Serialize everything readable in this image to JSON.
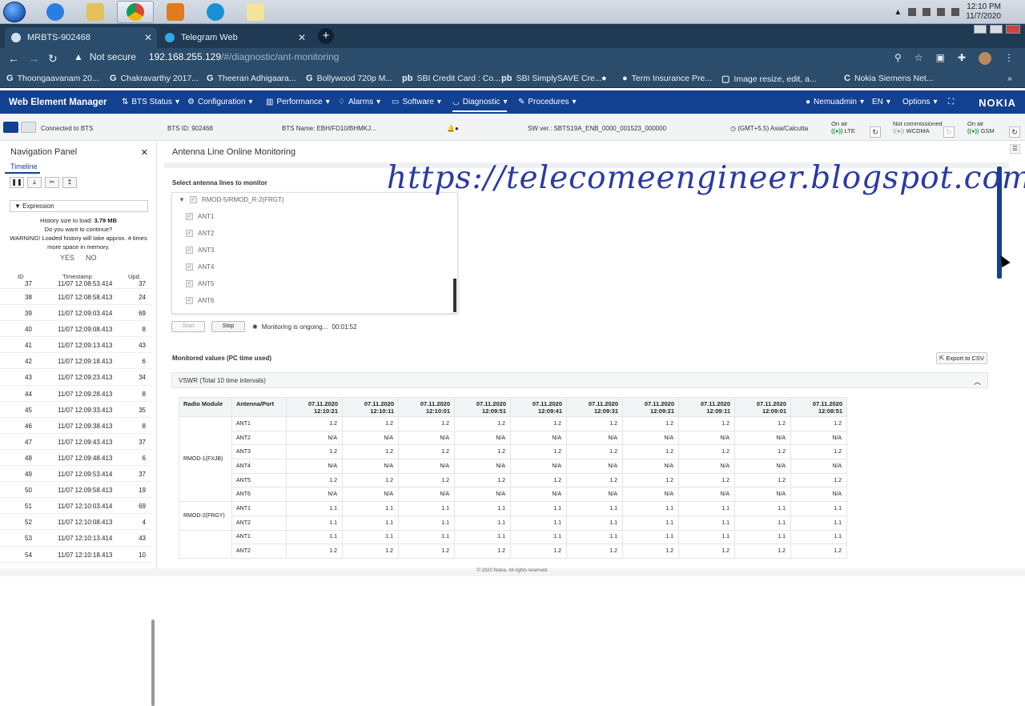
{
  "taskbar": {
    "clock_time": "12:10 PM",
    "clock_date": "11/7/2020"
  },
  "browser": {
    "tabs": [
      {
        "label": "MRBTS-902468",
        "active": true
      },
      {
        "label": "Telegram Web",
        "active": false
      }
    ],
    "new_tab": "+",
    "security_label": "Not secure",
    "url_host": "192.168.255.129",
    "url_path": "/#/diagnostic/ant-monitoring",
    "bookmarks": [
      {
        "icon": "G",
        "label": "Thoongaavanam 20..."
      },
      {
        "icon": "G",
        "label": "Chakravarthy 2017..."
      },
      {
        "icon": "G",
        "label": "Theeran Adhigaara..."
      },
      {
        "icon": "G",
        "label": "Bollywood 720p M..."
      },
      {
        "icon": "pb",
        "label": "SBI Credit Card : Co..."
      },
      {
        "icon": "pb",
        "label": "SBI SimplySAVE Cre..."
      },
      {
        "icon": "●",
        "label": ""
      },
      {
        "icon": "●",
        "label": "Term Insurance Pre..."
      },
      {
        "icon": "▢",
        "label": "Image resize, edit, a..."
      },
      {
        "icon": "C",
        "label": "Nokia Siemens Net..."
      }
    ]
  },
  "app": {
    "brand": "Web Element Manager",
    "menus": [
      {
        "label": "BTS Status"
      },
      {
        "label": "Configuration"
      },
      {
        "label": "Performance"
      },
      {
        "label": "Alarms"
      },
      {
        "label": "Software"
      },
      {
        "label": "Diagnostic"
      },
      {
        "label": "Procedures"
      }
    ],
    "user": "Nemuadmin",
    "language": "EN",
    "options": "Options",
    "logo": "NOKIA"
  },
  "status": {
    "connected": "Connected to BTS",
    "bts_id": "BTS ID:  902468",
    "bts_name": "BTS Name:  EBH/FD10/BHMKJ...",
    "sw_ver": "SW ver.:  SBTS19A_ENB_0000_001523_000000",
    "timezone": "(GMT+5.5) Asia/Calcutta",
    "lte_label": "On air",
    "lte_tech": "LTE",
    "wcdma_label": "Not commissioned",
    "wcdma_tech": "WCDMA",
    "gsm_label": "On air",
    "gsm_tech": "GSM"
  },
  "nav_panel": {
    "title": "Navigation Panel",
    "tab": "Timeline",
    "expression": "Expression",
    "history_line1": "History size to load: ",
    "history_size": "3.79 MB",
    "history_line2": "Do you want to continue?",
    "history_warning": "WARNING! Loaded history will take approx. 4 times more space in memory.",
    "yes": "YES",
    "no": "NO",
    "col_id": "ID",
    "col_ts": "Timestamp",
    "col_upd": "Upd.",
    "rows": [
      {
        "id": "37",
        "ts": "11/07 12:08:53.414",
        "upd": "37"
      },
      {
        "id": "38",
        "ts": "11/07 12:08:58.413",
        "upd": "24"
      },
      {
        "id": "39",
        "ts": "11/07 12:09:03.414",
        "upd": "69"
      },
      {
        "id": "40",
        "ts": "11/07 12:09:08.413",
        "upd": "8"
      },
      {
        "id": "41",
        "ts": "11/07 12:09:13.413",
        "upd": "43"
      },
      {
        "id": "42",
        "ts": "11/07 12:09:18.413",
        "upd": "6"
      },
      {
        "id": "43",
        "ts": "11/07 12:09:23.413",
        "upd": "34"
      },
      {
        "id": "44",
        "ts": "11/07 12:09:28.413",
        "upd": "8"
      },
      {
        "id": "45",
        "ts": "11/07 12:09:33.413",
        "upd": "35"
      },
      {
        "id": "46",
        "ts": "11/07 12:09:38.413",
        "upd": "8"
      },
      {
        "id": "47",
        "ts": "11/07 12:09:43.413",
        "upd": "37"
      },
      {
        "id": "48",
        "ts": "11/07 12:09:48.413",
        "upd": "6"
      },
      {
        "id": "49",
        "ts": "11/07 12:09:53.414",
        "upd": "37"
      },
      {
        "id": "50",
        "ts": "11/07 12:09:58.413",
        "upd": "19"
      },
      {
        "id": "51",
        "ts": "11/07 12:10:03.414",
        "upd": "69"
      },
      {
        "id": "52",
        "ts": "11/07 12:10:08.413",
        "upd": "4"
      },
      {
        "id": "53",
        "ts": "11/07 12:10:13.414",
        "upd": "43"
      },
      {
        "id": "54",
        "ts": "11/07 12:10:18.413",
        "upd": "10"
      }
    ]
  },
  "main": {
    "title": "Antenna Line Online Monitoring",
    "select_label": "Select antenna lines to monitor",
    "group": "RMOD-5/RMOD_R-2(FRGT)",
    "antennas": [
      "ANT1",
      "ANT2",
      "ANT3",
      "ANT4",
      "ANT5",
      "ANT6"
    ],
    "start": "Start",
    "stop": "Stop",
    "monitoring_text": "Monitoring is ongoing...",
    "monitoring_time": "00:01:52",
    "monitored_label": "Monitored values (PC time used)",
    "export": "Export to CSV",
    "vswr_title": "VSWR (Total 10 time intervals)",
    "col_module": "Radio Module",
    "col_port": "Antenna/Port",
    "time_cols": [
      {
        "date": "07.11.2020",
        "time": "12:10:21"
      },
      {
        "date": "07.11.2020",
        "time": "12:10:11"
      },
      {
        "date": "07.11.2020",
        "time": "12:10:01"
      },
      {
        "date": "07.11.2020",
        "time": "12:09:51"
      },
      {
        "date": "07.11.2020",
        "time": "12:09:41"
      },
      {
        "date": "07.11.2020",
        "time": "12:09:31"
      },
      {
        "date": "07.11.2020",
        "time": "12:09:21"
      },
      {
        "date": "07.11.2020",
        "time": "12:09:11"
      },
      {
        "date": "07.11.2020",
        "time": "12:09:01"
      },
      {
        "date": "07.11.2020",
        "time": "12:08:51"
      }
    ],
    "modules": [
      {
        "name": "RMOD-1(FXJB)",
        "ports": [
          {
            "port": "ANT1",
            "values": [
              "1.2",
              "1.2",
              "1.2",
              "1.2",
              "1.2",
              "1.2",
              "1.2",
              "1.2",
              "1.2",
              "1.2"
            ]
          },
          {
            "port": "ANT2",
            "values": [
              "N/A",
              "N/A",
              "N/A",
              "N/A",
              "N/A",
              "N/A",
              "N/A",
              "N/A",
              "N/A",
              "N/A"
            ]
          },
          {
            "port": "ANT3",
            "values": [
              "1.2",
              "1.2",
              "1.2",
              "1.2",
              "1.2",
              "1.2",
              "1.2",
              "1.2",
              "1.2",
              "1.2"
            ]
          },
          {
            "port": "ANT4",
            "values": [
              "N/A",
              "N/A",
              "N/A",
              "N/A",
              "N/A",
              "N/A",
              "N/A",
              "N/A",
              "N/A",
              "N/A"
            ]
          },
          {
            "port": "ANT5",
            "values": [
              "1.2",
              "1.2",
              "1.2",
              "1.2",
              "1.2",
              "1.2",
              "1.2",
              "1.2",
              "1.2",
              "1.2"
            ]
          },
          {
            "port": "ANT6",
            "values": [
              "N/A",
              "N/A",
              "N/A",
              "N/A",
              "N/A",
              "N/A",
              "N/A",
              "N/A",
              "N/A",
              "N/A"
            ]
          }
        ]
      },
      {
        "name": "RMOD-2(FRGY)",
        "ports": [
          {
            "port": "ANT1",
            "values": [
              "1.1",
              "1.1",
              "1.1",
              "1.1",
              "1.1",
              "1.1",
              "1.1",
              "1.1",
              "1.1",
              "1.1"
            ]
          },
          {
            "port": "ANT2",
            "values": [
              "1.1",
              "1.1",
              "1.1",
              "1.1",
              "1.1",
              "1.1",
              "1.1",
              "1.1",
              "1.1",
              "1.1"
            ]
          }
        ]
      },
      {
        "name": "",
        "ports": [
          {
            "port": "ANT1",
            "values": [
              "1.1",
              "1.1",
              "1.1",
              "1.1",
              "1.1",
              "1.1",
              "1.1",
              "1.1",
              "1.1",
              "1.1"
            ]
          },
          {
            "port": "ANT2",
            "values": [
              "1.2",
              "1.2",
              "1.2",
              "1.2",
              "1.2",
              "1.2",
              "1.2",
              "1.2",
              "1.2",
              "1.2"
            ]
          }
        ]
      }
    ]
  },
  "footer": "© 2020 Nokia. All rights reserved.",
  "watermark": "https://telecomeengineer.blogspot.com/"
}
